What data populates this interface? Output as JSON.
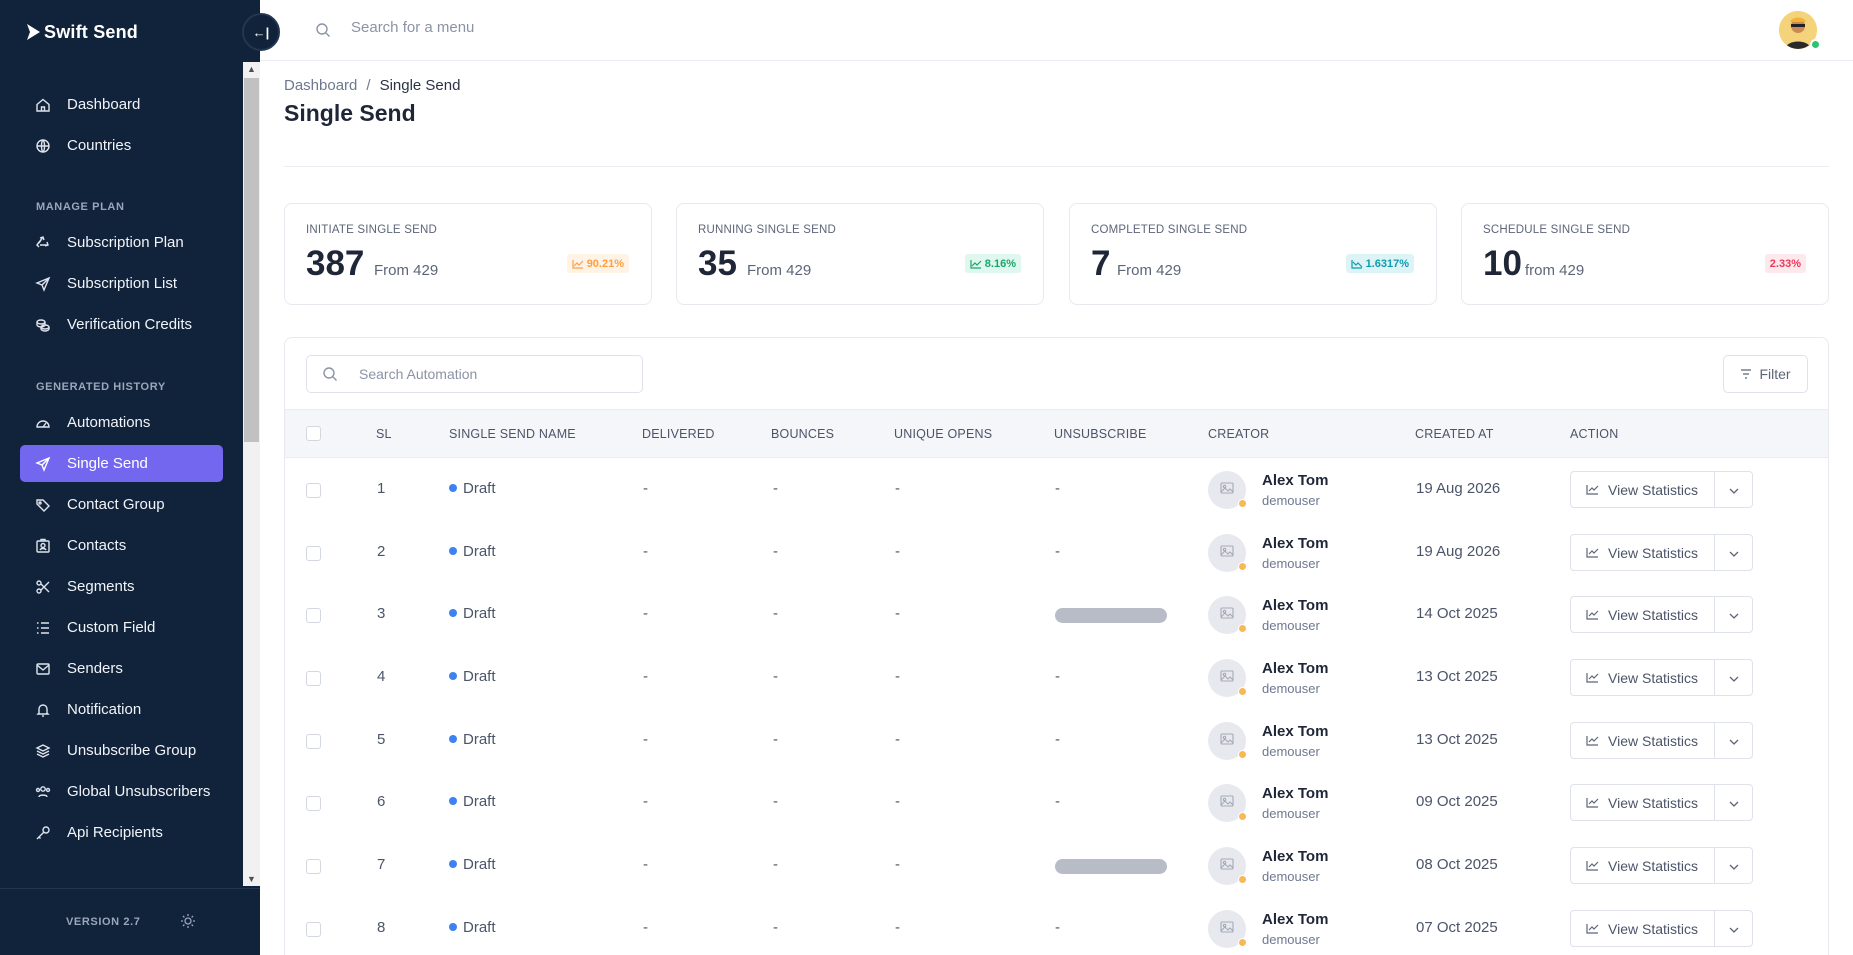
{
  "app": {
    "logo_text": "Swift Send"
  },
  "sidebar": {
    "items": [
      {
        "label": "Dashboard",
        "icon": "home-icon"
      },
      {
        "label": "Countries",
        "icon": "globe-icon"
      }
    ],
    "manage_plan_title": "MANAGE PLAN",
    "manage_plan": [
      {
        "label": "Subscription Plan",
        "icon": "recycle-icon"
      },
      {
        "label": "Subscription List",
        "icon": "send-icon"
      },
      {
        "label": "Verification Credits",
        "icon": "coins-icon"
      }
    ],
    "history_title": "GENERATED HISTORY",
    "history": [
      {
        "label": "Automations",
        "icon": "gauge-icon"
      },
      {
        "label": "Single Send",
        "icon": "send-icon",
        "active": true
      },
      {
        "label": "Contact Group",
        "icon": "tags-icon"
      },
      {
        "label": "Contacts",
        "icon": "id-card-icon"
      },
      {
        "label": "Segments",
        "icon": "scissors-icon"
      },
      {
        "label": "Custom Field",
        "icon": "list-icon"
      },
      {
        "label": "Senders",
        "icon": "mail-icon"
      },
      {
        "label": "Notification",
        "icon": "bell-icon"
      },
      {
        "label": "Unsubscribe Group",
        "icon": "layers-icon"
      },
      {
        "label": "Global Unsubscribers",
        "icon": "users-icon"
      },
      {
        "label": "Api Recipients",
        "icon": "key-icon"
      }
    ],
    "version": "VERSION 2.7"
  },
  "topbar": {
    "search_placeholder": "Search for a menu"
  },
  "breadcrumb": {
    "root": "Dashboard",
    "separator": "/",
    "current": "Single Send"
  },
  "page_title": "Single Send",
  "stats": [
    {
      "label": "INITIATE SINGLE SEND",
      "value": "387",
      "from": "From 429",
      "badge": "90.21%",
      "tone": "orange"
    },
    {
      "label": "RUNNING SINGLE SEND",
      "value": "35",
      "from": "From 429",
      "badge": "8.16%",
      "tone": "green"
    },
    {
      "label": "COMPLETED SINGLE SEND",
      "value": "7",
      "from": "From 429",
      "badge": "1.6317%",
      "tone": "cyan"
    },
    {
      "label": "SCHEDULE SINGLE SEND",
      "value": "10",
      "from": "from 429",
      "badge": "2.33%",
      "tone": "red"
    }
  ],
  "colors": {
    "accent": "#7367f0",
    "sidebar_bg": "#11223b",
    "draft_dot": "#3d82f0"
  },
  "table": {
    "search_placeholder": "Search Automation",
    "filter_label": "Filter",
    "headers": [
      "SL",
      "SINGLE SEND NAME",
      "DELIVERED",
      "BOUNCES",
      "UNIQUE OPENS",
      "UNSUBSCRIBE",
      "CREATOR",
      "CREATED AT",
      "ACTION"
    ],
    "action_label": "View Statistics",
    "rows": [
      {
        "sl": "1",
        "name": "Draft",
        "delivered": "-",
        "bounces": "-",
        "opens": "-",
        "unsubscribe": "-",
        "creator": "Alex Tom",
        "username": "demouser",
        "created": "19 Aug 2026"
      },
      {
        "sl": "2",
        "name": "Draft",
        "delivered": "-",
        "bounces": "-",
        "opens": "-",
        "unsubscribe": "-",
        "creator": "Alex Tom",
        "username": "demouser",
        "created": "19 Aug 2026"
      },
      {
        "sl": "3",
        "name": "Draft",
        "delivered": "-",
        "bounces": "-",
        "opens": "-",
        "unsubscribe": "",
        "creator": "Alex Tom",
        "username": "demouser",
        "created": "14 Oct 2025"
      },
      {
        "sl": "4",
        "name": "Draft",
        "delivered": "-",
        "bounces": "-",
        "opens": "-",
        "unsubscribe": "-",
        "creator": "Alex Tom",
        "username": "demouser",
        "created": "13 Oct 2025"
      },
      {
        "sl": "5",
        "name": "Draft",
        "delivered": "-",
        "bounces": "-",
        "opens": "-",
        "unsubscribe": "-",
        "creator": "Alex Tom",
        "username": "demouser",
        "created": "13 Oct 2025"
      },
      {
        "sl": "6",
        "name": "Draft",
        "delivered": "-",
        "bounces": "-",
        "opens": "-",
        "unsubscribe": "-",
        "creator": "Alex Tom",
        "username": "demouser",
        "created": "09 Oct 2025"
      },
      {
        "sl": "7",
        "name": "Draft",
        "delivered": "-",
        "bounces": "-",
        "opens": "-",
        "unsubscribe": "",
        "creator": "Alex Tom",
        "username": "demouser",
        "created": "08 Oct 2025"
      },
      {
        "sl": "8",
        "name": "Draft",
        "delivered": "-",
        "bounces": "-",
        "opens": "-",
        "unsubscribe": "-",
        "creator": "Alex Tom",
        "username": "demouser",
        "created": "07 Oct 2025"
      }
    ]
  }
}
